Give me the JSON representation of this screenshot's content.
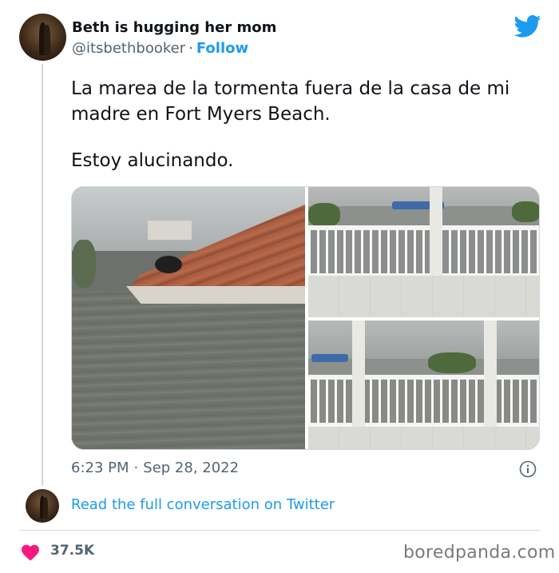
{
  "author": {
    "name": "Beth is hugging her mom",
    "handle": "@itsbethbooker",
    "separator": "·",
    "follow_label": "Follow"
  },
  "tweet": {
    "paragraphs": [
      "La marea de la tormenta fuera de la casa de mi madre en Fort Myers Beach.",
      "Estoy alucinando."
    ],
    "time": "6:23 PM",
    "separator": "·",
    "date": "Sep 28, 2022"
  },
  "media": {
    "photos": [
      {
        "name": "roof-flood-photo"
      },
      {
        "name": "porch-flood-photo-1"
      },
      {
        "name": "porch-flood-photo-2"
      }
    ]
  },
  "conversation": {
    "link_label": "Read the full conversation on Twitter"
  },
  "engagement": {
    "likes": "37.5K"
  },
  "watermark": "boredpanda.com",
  "icons": {
    "logo": "twitter-bird-icon",
    "info": "info-icon",
    "like": "heart-icon"
  },
  "colors": {
    "link_blue": "#1d9bf0",
    "text_primary": "#0f1419",
    "text_secondary": "#536471",
    "heart_pink": "#f91880",
    "border": "#cfd9de"
  }
}
